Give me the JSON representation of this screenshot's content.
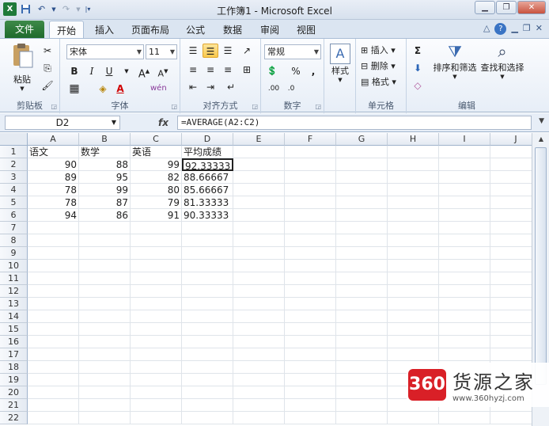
{
  "window": {
    "title": "工作簿1 - Microsoft Excel"
  },
  "tabs": {
    "file": "文件",
    "items": [
      "开始",
      "插入",
      "页面布局",
      "公式",
      "数据",
      "审阅",
      "视图"
    ],
    "active": "开始"
  },
  "ribbon": {
    "clipboard": {
      "label": "剪贴板",
      "paste": "粘贴"
    },
    "font": {
      "label": "字体",
      "name": "宋体",
      "size": "11",
      "bold": "B",
      "italic": "I",
      "underline": "U"
    },
    "alignment": {
      "label": "对齐方式"
    },
    "number": {
      "label": "数字",
      "format": "常规",
      "percent": "%",
      "comma": ","
    },
    "styles": {
      "label": "样式"
    },
    "cells": {
      "label": "单元格",
      "insert": "插入",
      "delete": "删除",
      "format": "格式"
    },
    "editing": {
      "label": "编辑",
      "sort": "排序和筛选",
      "find": "查找和选择",
      "sum": "Σ"
    }
  },
  "formula_bar": {
    "name_box": "D2",
    "fx": "fx",
    "formula": "=AVERAGE(A2:C2)"
  },
  "sheet": {
    "columns": [
      "A",
      "B",
      "C",
      "D",
      "E",
      "F",
      "G",
      "H",
      "I",
      "J"
    ],
    "row_numbers": [
      "1",
      "2",
      "3",
      "4",
      "5",
      "6",
      "7",
      "8",
      "9",
      "10",
      "11",
      "12",
      "13",
      "14",
      "15",
      "16",
      "17",
      "18",
      "19",
      "20",
      "21",
      "22"
    ],
    "headers": [
      "语文",
      "数学",
      "英语",
      "平均成绩"
    ],
    "rows": [
      [
        "90",
        "88",
        "99",
        "92.33333"
      ],
      [
        "89",
        "95",
        "82",
        "88.66667"
      ],
      [
        "78",
        "99",
        "80",
        "85.66667"
      ],
      [
        "78",
        "87",
        "79",
        "81.33333"
      ],
      [
        "94",
        "86",
        "91",
        "90.33333"
      ]
    ]
  },
  "watermark": {
    "badge": "360",
    "name": "货源之家",
    "url": "www.360hyzj.com"
  }
}
